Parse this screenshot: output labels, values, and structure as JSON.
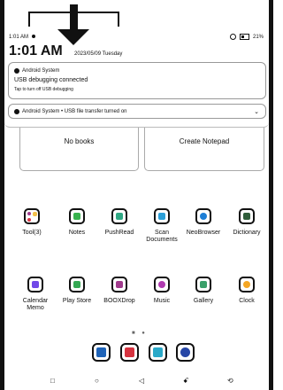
{
  "status_bar": {
    "time": "1:01 AM",
    "battery": "21%"
  },
  "shade": {
    "big_time": "1:01 AM",
    "date": "2023/05/09 Tuesday"
  },
  "notifications": [
    {
      "app": "Android System",
      "title": "USB debugging connected",
      "text": "Tap to turn off USB debugging"
    },
    {
      "summary": "Android System • USB file transfer turned on"
    }
  ],
  "tiles": [
    {
      "label": "No books"
    },
    {
      "label": "Create Notepad"
    }
  ],
  "apps_row1": [
    {
      "label": "Tool(3)",
      "color": "#f2c04a"
    },
    {
      "label": "Notes",
      "color": "#37b24d"
    },
    {
      "label": "PushRead",
      "color": "#2fa884"
    },
    {
      "label": "Scan Documents",
      "color": "#2b9fd8"
    },
    {
      "label": "NeoBrowser",
      "color": "#1c7ed6"
    },
    {
      "label": "Dictionary",
      "color": "#2f5d3a"
    }
  ],
  "apps_row2": [
    {
      "label": "Calendar Memo",
      "color": "#7048e8"
    },
    {
      "label": "Play Store",
      "color": "#34a853"
    },
    {
      "label": "BOOXDrop",
      "color": "#a03a8c"
    },
    {
      "label": "Music",
      "color": "#b03ab0"
    },
    {
      "label": "Gallery",
      "color": "#3aa06a"
    },
    {
      "label": "Clock",
      "color": "#f5a623"
    }
  ],
  "pager": "■ ●",
  "dock": [
    {
      "name": "library",
      "color": "#1e63b8"
    },
    {
      "name": "store",
      "color": "#d6333f"
    },
    {
      "name": "files",
      "color": "#2aa9c9"
    },
    {
      "name": "settings",
      "color": "#2646a6"
    }
  ],
  "navbar": {
    "square": "□",
    "home": "○",
    "back": "◁",
    "refresh": "ꗃ",
    "rotate": "⟲"
  }
}
